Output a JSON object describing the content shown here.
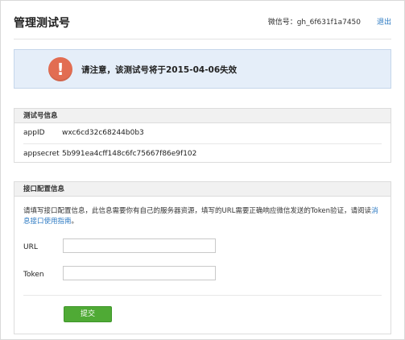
{
  "header": {
    "title": "管理测试号",
    "wechat_id": "微信号：gh_6f631f1a7450",
    "logout": "退出"
  },
  "notice": {
    "icon": "exclamation-icon",
    "icon_glyph": "!",
    "text": "请注意，该测试号将于2015-04-06失效"
  },
  "info": {
    "heading": "测试号信息",
    "rows": [
      {
        "label": "appID",
        "value": "wxc6cd32c68244b0b3"
      },
      {
        "label": "appsecret",
        "value": "5b991ea4cff148c6fc75667f86e9f102"
      }
    ]
  },
  "config": {
    "heading": "接口配置信息",
    "desc_prefix": "请填写接口配置信息，此信息需要你有自己的服务器资源，填写的URL需要正确响应微信发送的Token验证，请阅读",
    "desc_link": "消息接口使用指南",
    "desc_suffix": "。",
    "url_label": "URL",
    "url_value": "",
    "token_label": "Token",
    "token_value": "",
    "submit": "提交"
  },
  "colors": {
    "accent_link": "#2a78c2",
    "submit_green": "#4faa35",
    "warning_red": "#e26d52",
    "notice_bg": "#e5eef9"
  }
}
